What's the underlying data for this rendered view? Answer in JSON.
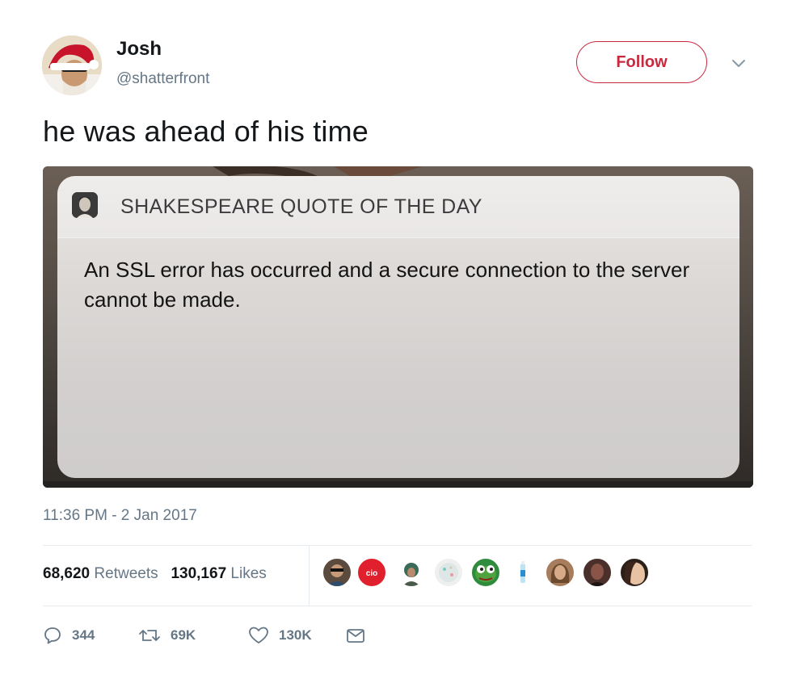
{
  "author": {
    "name": "Josh",
    "handle": "@shatterfront"
  },
  "header": {
    "follow_label": "Follow"
  },
  "tweet": {
    "text": "he was ahead of his time",
    "timestamp": "11:36 PM - 2 Jan 2017"
  },
  "notification": {
    "app_name": "SHAKESPEARE QUOTE OF THE DAY",
    "message": "An SSL error has occurred and a secure connection to the server cannot be made."
  },
  "stats": {
    "retweets_count": "68,620",
    "retweets_label": "Retweets",
    "likes_count": "130,167",
    "likes_label": "Likes"
  },
  "actions": {
    "reply_count": "344",
    "retweet_count": "69K",
    "like_count": "130K"
  },
  "likers_count": 9,
  "colors": {
    "accent": "#c8293f",
    "secondary_text": "#657786",
    "divider": "#e6ecf0"
  },
  "icons": [
    "caret-down-icon",
    "reply-icon",
    "retweet-icon",
    "like-icon",
    "dm-icon"
  ]
}
